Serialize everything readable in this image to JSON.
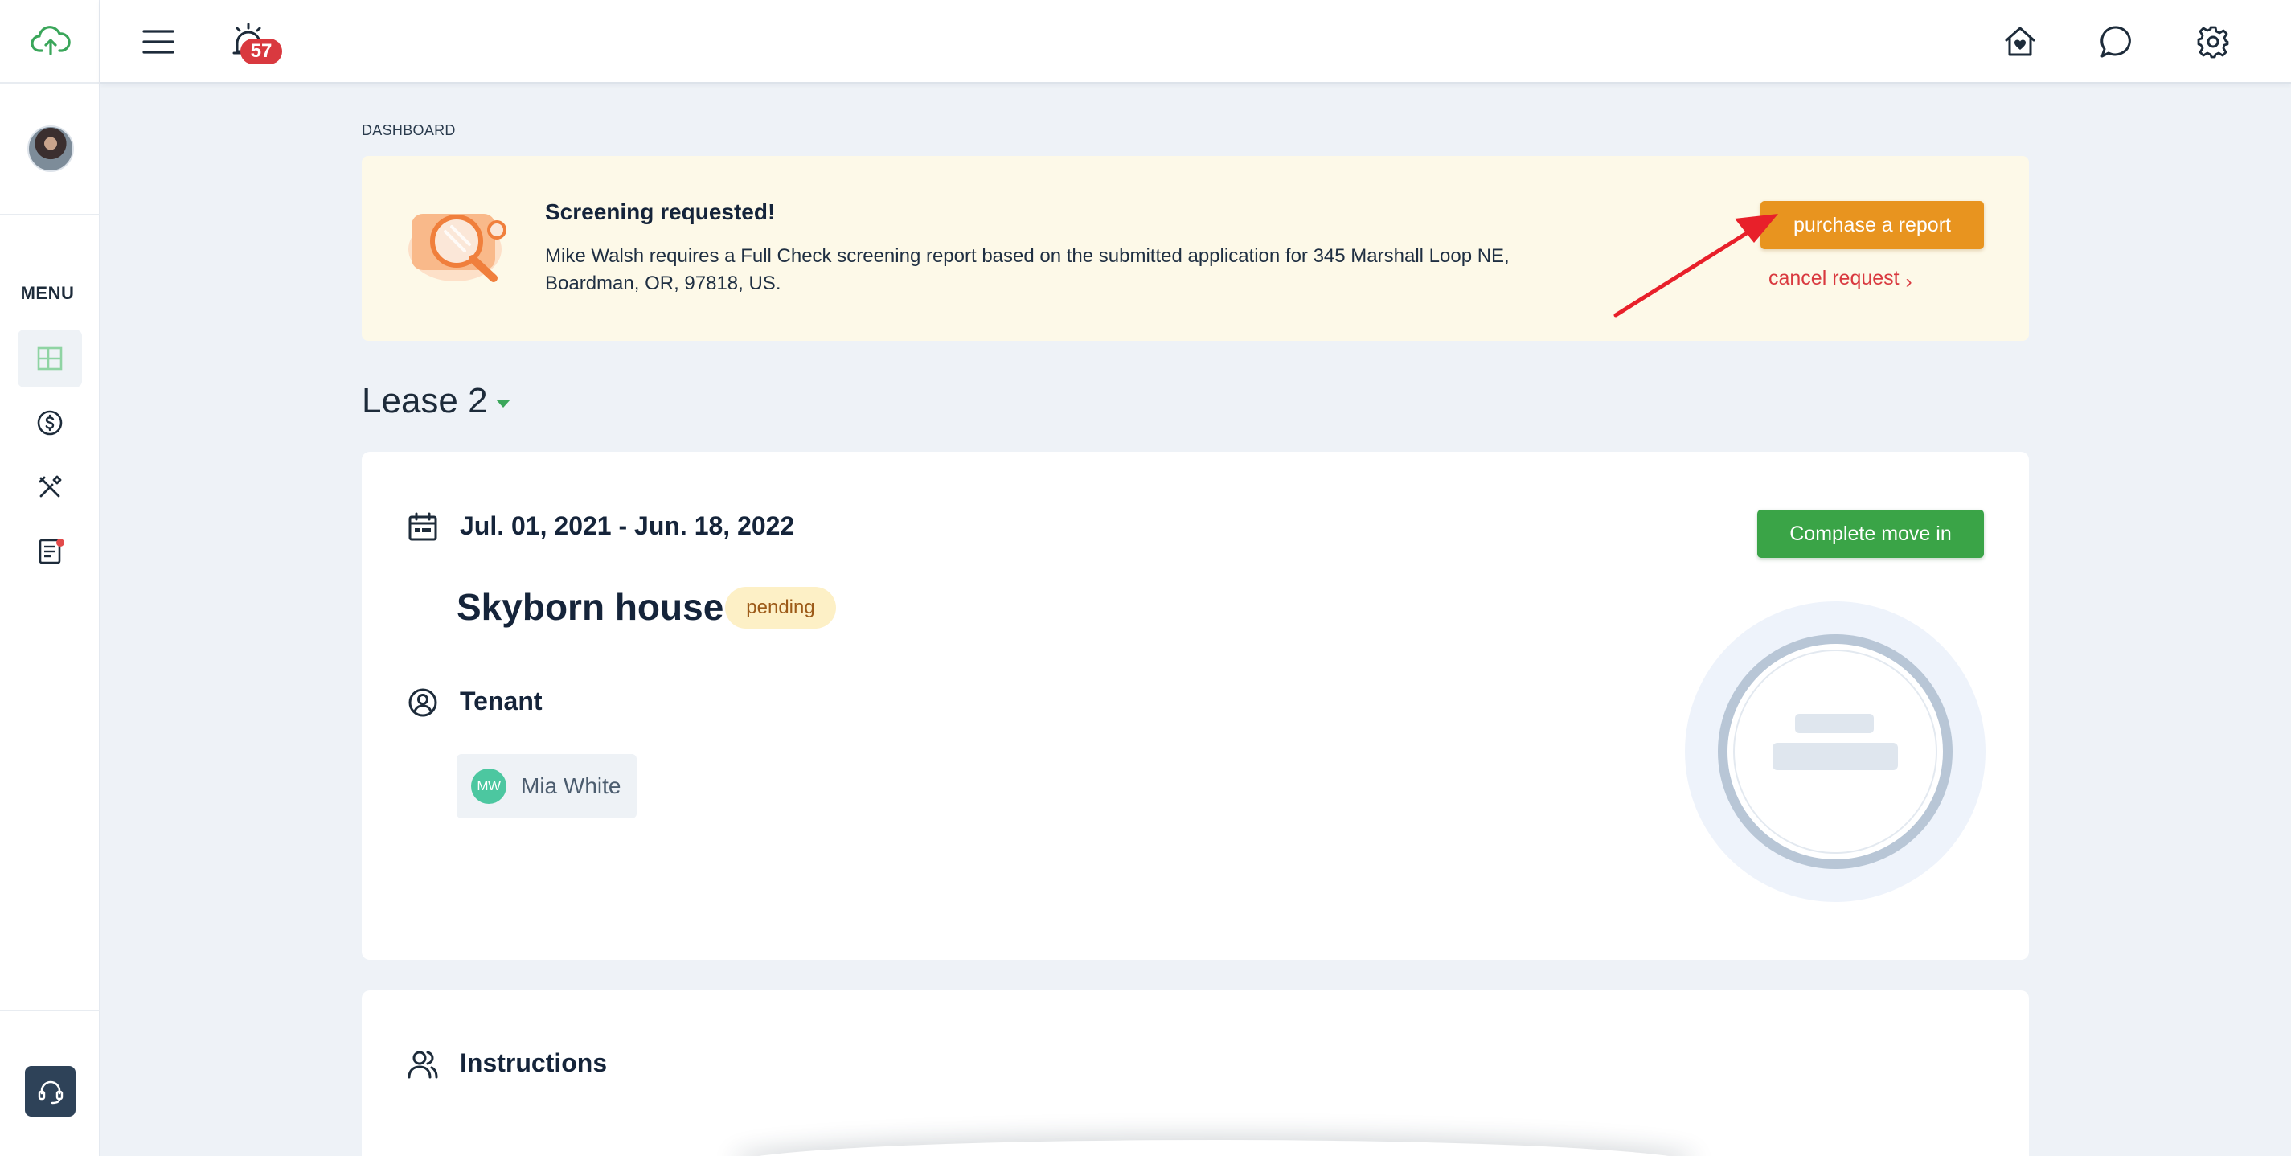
{
  "sidebar": {
    "menu_label": "MENU",
    "items": [
      {
        "name": "dashboard",
        "icon": "dashboard-icon",
        "active": true
      },
      {
        "name": "payments",
        "icon": "dollar-circle-icon",
        "active": false
      },
      {
        "name": "maintenance",
        "icon": "tools-icon",
        "active": false
      },
      {
        "name": "documents",
        "icon": "document-icon",
        "active": false,
        "notification_dot": true
      }
    ]
  },
  "topbar": {
    "notification_count": "57",
    "icons": [
      "menu-icon",
      "alarm-icon",
      "home-heart-icon",
      "chat-icon",
      "gear-icon"
    ]
  },
  "breadcrumb": "DASHBOARD",
  "alert": {
    "title": "Screening requested!",
    "message": "Mike Walsh requires a Full Check screening report based on the submitted application for 345 Marshall Loop NE, Boardman, OR, 97818, US.",
    "primary_button": "purchase a report",
    "cancel_link": "cancel request",
    "cancel_chevron": "›"
  },
  "lease": {
    "title": "Lease 2",
    "date_range": "Jul. 01, 2021 - Jun. 18, 2022",
    "property_name": "Skyborn house",
    "status": "pending",
    "tenant_label": "Tenant",
    "tenant": {
      "initials": "MW",
      "name": "Mia White"
    },
    "complete_button": "Complete move in"
  },
  "instructions": {
    "label": "Instructions"
  },
  "colors": {
    "accent_green": "#3aa447",
    "accent_orange": "#e8941f",
    "alert_bg": "#fdf9e8",
    "danger_red": "#d9393f",
    "page_bg": "#eef2f7"
  }
}
